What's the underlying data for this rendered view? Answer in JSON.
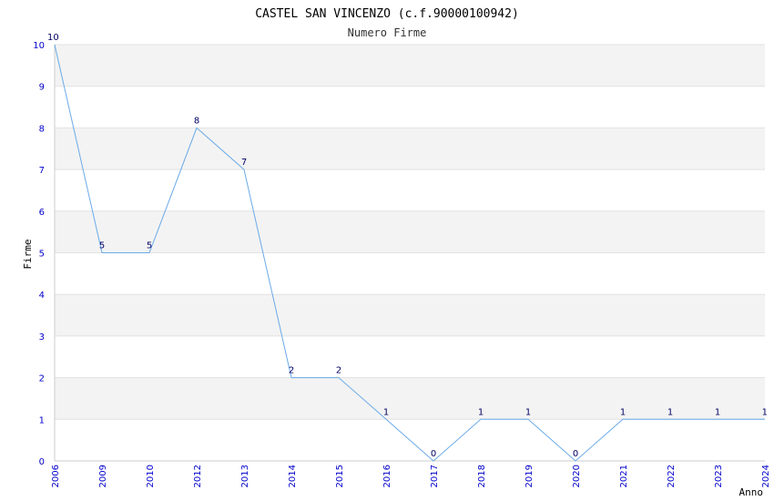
{
  "chart_data": {
    "type": "line",
    "title": "CASTEL SAN VINCENZO (c.f.90000100942)",
    "subtitle": "Numero Firme",
    "xlabel": "Anno",
    "ylabel": "Firme",
    "categories": [
      "2006",
      "2009",
      "2010",
      "2012",
      "2013",
      "2014",
      "2015",
      "2016",
      "2017",
      "2018",
      "2019",
      "2020",
      "2021",
      "2022",
      "2023",
      "2024"
    ],
    "values": [
      10,
      5,
      5,
      8,
      7,
      2,
      2,
      1,
      0,
      1,
      1,
      0,
      1,
      1,
      1,
      1
    ],
    "ylim": [
      0,
      10
    ],
    "yticks": [
      0,
      1,
      2,
      3,
      4,
      5,
      6,
      7,
      8,
      9,
      10
    ],
    "grid": true,
    "colors": {
      "line": "#6aaae8",
      "band": "#f3f3f3",
      "tick": "#0000cc"
    }
  }
}
